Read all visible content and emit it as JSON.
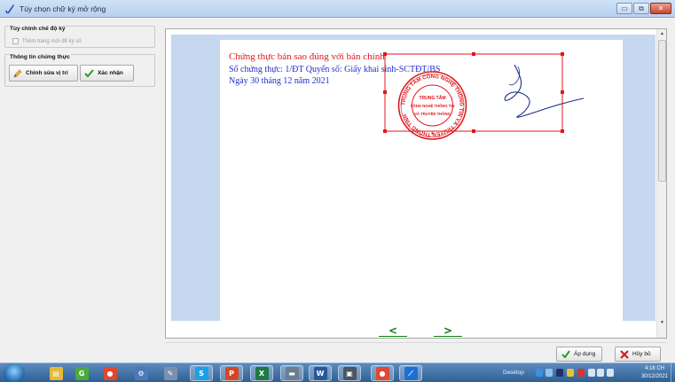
{
  "window": {
    "title": "Tùy chọn chữ ký mở rộng",
    "minimize_glyph": "▭",
    "restore_glyph": "⧉",
    "close_glyph": "✕"
  },
  "sig_options": {
    "title": "Tùy chỉnh chế độ ký",
    "checkbox_label": "Thêm trang mới để ký số",
    "checked": false
  },
  "cert_info": {
    "title": "Thông tin chứng thực",
    "edit_position_label": "Chỉnh sửa vị trí",
    "confirm_label": "Xác nhận"
  },
  "document": {
    "line1": "Chứng thực bản sao đúng với bản chính",
    "line2": "Số chứng thực: 1/ĐT Quyển số: Giấy khai sinh-SCTĐT/BS",
    "line3": "Ngày 30 tháng 12 năm 2021",
    "stamp": {
      "outer_text": "TRUNG TÂM CÔNG NGHỆ THÔNG TIN VÀ TRUYỀN THÔNG TỈNH",
      "center_lines": [
        "TRUNG TÂM",
        "CÔNG NGHỆ THÔNG TIN",
        "VÀ TRUYỀN THÔNG"
      ],
      "stamp_color": "#e0161b",
      "signature_color": "#1b2f8a"
    },
    "selection_color": "#e0161b"
  },
  "nav": {
    "prev_label": "<",
    "next_label": ">"
  },
  "actions": {
    "apply_label": "Áp dụng",
    "cancel_label": "Hủy bỏ"
  },
  "taskbar": {
    "desktop_label": "Desktop",
    "time": "4:18 CH",
    "date": "30/12/2021",
    "apps": [
      {
        "name": "file-explorer",
        "glyph": "▤",
        "color": "#e6b93a"
      },
      {
        "name": "green-app",
        "glyph": "G",
        "color": "#4caa3b"
      },
      {
        "name": "chrome",
        "glyph": "●",
        "color": "#e0482f"
      },
      {
        "name": "network-tool",
        "glyph": "⚙",
        "color": "#4d79b9"
      },
      {
        "name": "paint-tool",
        "glyph": "✎",
        "color": "#7b8fb3"
      },
      {
        "name": "chat-app",
        "glyph": "S",
        "color": "#1aa0e8"
      },
      {
        "name": "powerpoint",
        "glyph": "P",
        "color": "#d24726"
      },
      {
        "name": "excel",
        "glyph": "X",
        "color": "#1e7a45"
      },
      {
        "name": "device-app",
        "glyph": "▬",
        "color": "#6c7d92"
      },
      {
        "name": "word",
        "glyph": "W",
        "color": "#2b579a"
      },
      {
        "name": "scanner",
        "glyph": "▣",
        "color": "#4b5563"
      },
      {
        "name": "chrome-2",
        "glyph": "●",
        "color": "#e0482f"
      },
      {
        "name": "signing-app",
        "glyph": "⟋",
        "color": "#1f6fd1"
      }
    ],
    "tray": [
      {
        "name": "tray-cloud",
        "color": "#3b8fe0"
      },
      {
        "name": "tray-app-1",
        "color": "#8fc4ea"
      },
      {
        "name": "tray-app-2",
        "color": "#1f2f6f"
      },
      {
        "name": "tray-flag",
        "color": "#e7c33c"
      },
      {
        "name": "tray-shield",
        "color": "#d6362b"
      },
      {
        "name": "tray-volume",
        "color": "#d8e4f2"
      },
      {
        "name": "tray-network",
        "color": "#d8e4f2"
      },
      {
        "name": "tray-keyboard",
        "color": "#d8e4f2"
      }
    ]
  }
}
